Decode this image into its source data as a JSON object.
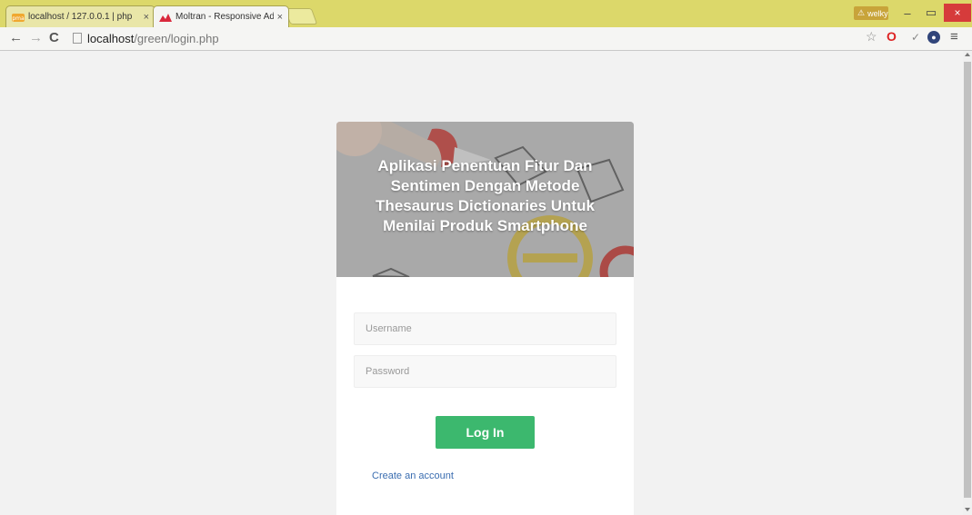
{
  "browser": {
    "tabs": [
      {
        "label": "localhost / 127.0.0.1 | php",
        "close": "×"
      },
      {
        "label": "Moltran - Responsive Adm",
        "close": "×"
      }
    ],
    "profile_name": "welky",
    "window": {
      "minimize": "–",
      "restore": "▭",
      "close": "×"
    },
    "url_host": "localhost",
    "url_path": "/green/login.php"
  },
  "login": {
    "title": "Aplikasi Penentuan Fitur Dan Sentimen Dengan Metode Thesaurus Dictionaries Untuk Menilai Produk Smartphone",
    "username_placeholder": "Username",
    "password_placeholder": "Password",
    "login_label": "Log In",
    "create_account": "Create an account"
  },
  "colors": {
    "tab_strip": "#dcd86a",
    "login_button": "#3cb86e",
    "link": "#3a6db0",
    "window_close": "#d63b3b"
  }
}
